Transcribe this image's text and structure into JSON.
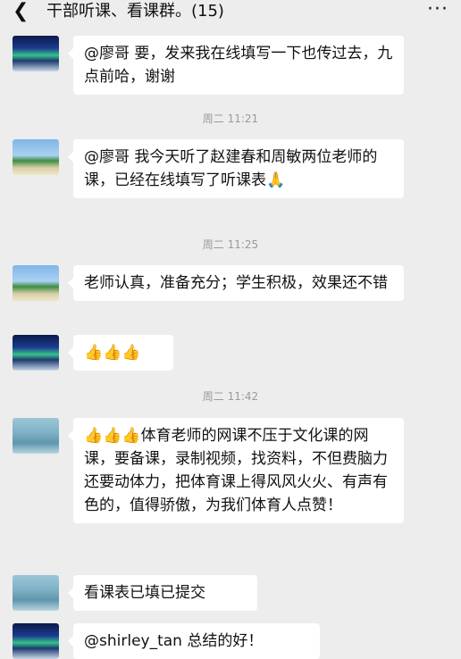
{
  "header": {
    "back_icon": "chevron-left-icon",
    "title": "干部听课、看课群。(15)",
    "more_icon": "ellipsis-icon"
  },
  "messages": [
    {
      "avatar": "aurora",
      "text": "@廖哥  要，发来我在线填写一下也传过去，九点前哈，谢谢"
    },
    {
      "avatar": "beach",
      "text": "@廖哥  我今天听了赵建春和周敏两位老师的课，已经在线填写了听课表🙏"
    },
    {
      "avatar": "beach",
      "text": "老师认真，准备充分；学生积极，效果还不错"
    },
    {
      "avatar": "aurora",
      "text": "👍👍👍"
    },
    {
      "avatar": "sea",
      "text": "👍👍👍体育老师的网课不压于文化课的网课，要备课，录制视频，找资料，不但费脑力还要动体力，把体育课上得风风火火、有声有色的，值得骄傲，为我们体育人点赞！"
    },
    {
      "avatar": "sea",
      "text": "看课表已填已提交"
    },
    {
      "avatar": "aurora",
      "text": "@shirley_tan  总结的好！"
    }
  ],
  "timestamps": [
    "周二 11:21",
    "周二 11:25",
    "周二 11:42"
  ]
}
